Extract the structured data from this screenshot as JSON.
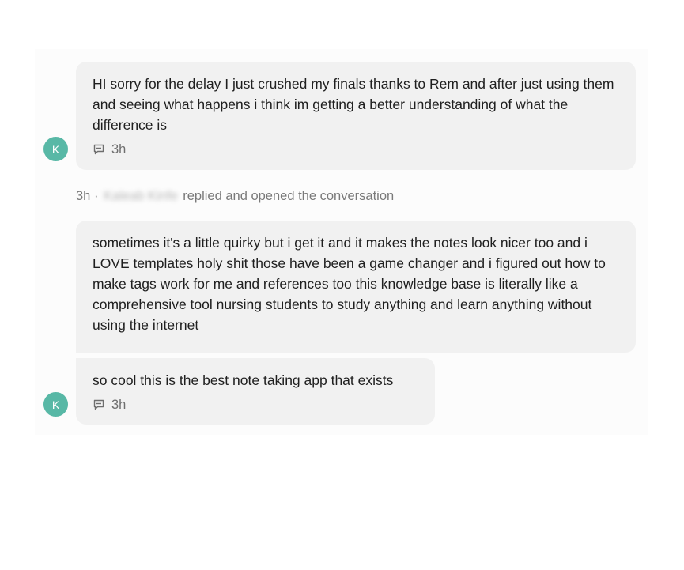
{
  "conversation": {
    "messages": [
      {
        "text": "HI sorry for the delay I just crushed my finals thanks to Rem and after just using them and seeing what happens i think im getting a better understanding of what the difference is",
        "time": "3h",
        "avatar_initial": "K"
      },
      {
        "text": "sometimes it's a little quirky but i get it and it makes the notes look nicer too and i LOVE templates holy shit those have been a game changer and i figured out how to make tags work for me and references too this knowledge base is literally like a comprehensive tool nursing students to study anything and learn anything without using the internet"
      },
      {
        "text": "so cool this is the best note taking app that exists",
        "time": "3h",
        "avatar_initial": "K"
      }
    ],
    "event": {
      "time": "3h",
      "separator": "·",
      "actor": "Kaleab Kinfe",
      "action": "replied and opened the conversation"
    }
  },
  "colors": {
    "avatar": "#58b8a6",
    "bubble": "#f1f1f1",
    "thread_background": "#fcfcfc",
    "muted_text": "#7a7a7a"
  },
  "icons": {
    "reply": "reply-bubble-icon"
  }
}
